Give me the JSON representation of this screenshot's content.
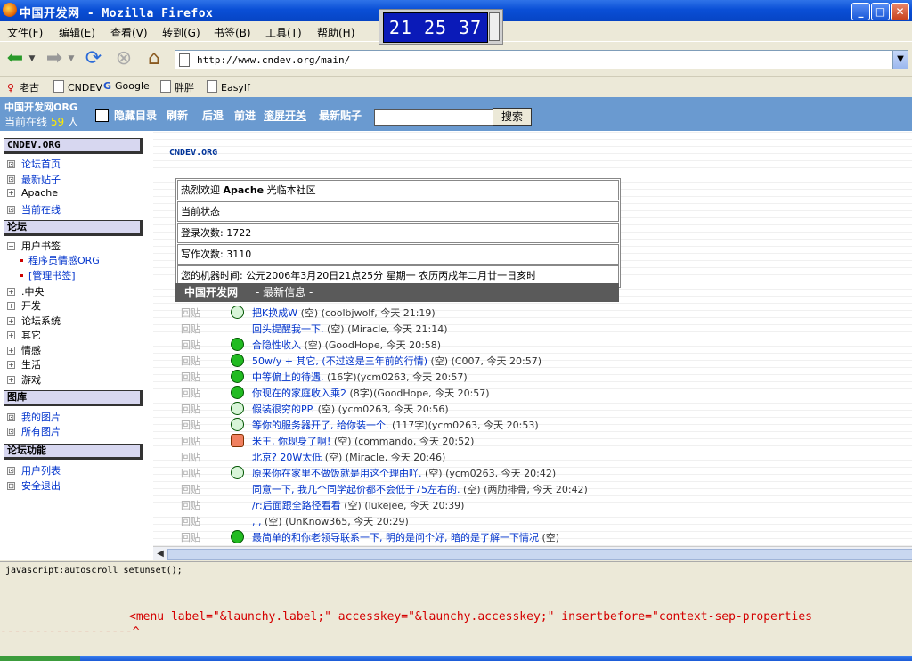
{
  "window": {
    "title": "中国开发网 - Mozilla Firefox",
    "clock": "21 25 37",
    "buttons": {
      "minimize": "_",
      "maximize": "□",
      "close": "✕"
    }
  },
  "menu": [
    "文件(F)",
    "编辑(E)",
    "查看(V)",
    "转到(G)",
    "书签(B)",
    "工具(T)",
    "帮助(H)"
  ],
  "address": {
    "url": "http://www.cndev.org/main/"
  },
  "bookmarks": [
    "老古",
    "CNDEV",
    "Google",
    "胖胖",
    "Easylf"
  ],
  "forum_bar": {
    "brand": "中国开发网ORG",
    "online_prefix": "当前在线",
    "online_count": "59",
    "online_suffix": "人",
    "toolbar": [
      "隐藏目录",
      "刷新",
      "后退",
      "前进",
      "滚屏开关",
      "最新贴子"
    ],
    "search_label": "搜索"
  },
  "sidebar": {
    "section1": "CNDEV.ORG",
    "items1": [
      {
        "box": "⊡",
        "label": "论坛首页"
      },
      {
        "box": "⊡",
        "label": "最新贴子"
      },
      {
        "box": "+",
        "label": "Apache"
      },
      {
        "box": "⊡",
        "label": "当前在线"
      }
    ],
    "section2": "论坛",
    "items2": [
      {
        "box": "−",
        "label": "用户书签"
      }
    ],
    "sub2": [
      "程序员情感ORG",
      "[管理书签]"
    ],
    "items2b": [
      {
        "box": "+",
        "label": ".中央"
      },
      {
        "box": "+",
        "label": "开发"
      },
      {
        "box": "+",
        "label": "论坛系统"
      },
      {
        "box": "+",
        "label": "其它"
      },
      {
        "box": "+",
        "label": "情感"
      },
      {
        "box": "+",
        "label": "生活"
      },
      {
        "box": "+",
        "label": "游戏"
      }
    ],
    "section3": "图库",
    "items3": [
      {
        "box": "⊡",
        "label": "我的图片"
      },
      {
        "box": "⊡",
        "label": "所有图片"
      }
    ],
    "section4": "论坛功能",
    "items4": [
      {
        "box": "⊡",
        "label": "用户列表"
      },
      {
        "box": "⊡",
        "label": "安全退出"
      }
    ]
  },
  "main": {
    "site_title": "CNDEV.ORG",
    "welcome_prefix": "热烈欢迎",
    "welcome_user": "Apache",
    "welcome_suffix": "光临本社区",
    "status_title": "当前状态",
    "login_count": "登录次数: 1722",
    "post_count": "写作次数: 3110",
    "machine_time": "您的机器时间: 公元2006年3月20日21点25分 星期一 农历丙戌年二月廿一日亥时",
    "news_title": "中国开发网",
    "news_subtitle": "- 最新信息 -",
    "reply_label": "回贴",
    "news": [
      {
        "title": "把K换成W",
        "meta": "(空) (coolbjwolf, 今天 21:19)",
        "emote": "ring"
      },
      {
        "title": "回头提醒我一下.",
        "meta": "(空) (Miracle, 今天 21:14)",
        "emote": "none"
      },
      {
        "title": "合隐性收入",
        "meta": "(空) (GoodHope, 今天 20:58)",
        "emote": "smile"
      },
      {
        "title": "50w/y + 其它, (不过这是三年前的行情)",
        "meta": "(空) (C007, 今天 20:57)",
        "emote": "smile"
      },
      {
        "title": "中等偏上的待遇,",
        "meta": "(16字)(ycm0263, 今天 20:57)",
        "emote": "smile"
      },
      {
        "title": "你现在的家庭收入乘2",
        "meta": "(8字)(GoodHope, 今天 20:57)",
        "emote": "smile"
      },
      {
        "title": "假装很穷的PP.",
        "meta": "(空) (ycm0263, 今天 20:56)",
        "emote": "ring"
      },
      {
        "title": "等你的服务器开了, 给你装一个.",
        "meta": "(117字)(ycm0263, 今天 20:53)",
        "emote": "ring"
      },
      {
        "title": "米王, 你现身了啊!",
        "meta": "(空) (commando, 今天 20:52)",
        "emote": "hand"
      },
      {
        "title": "北京? 20W太低",
        "meta": "(空) (Miracle, 今天 20:46)",
        "emote": "none"
      },
      {
        "title": "原来你在家里不做饭就是用这个理由吖.",
        "meta": "(空) (ycm0263, 今天 20:42)",
        "emote": "ring"
      },
      {
        "title": "同意一下, 我几个同学起价都不会低于75左右的.",
        "meta": "(空) (两肋排骨, 今天 20:42)",
        "emote": "none"
      },
      {
        "title": "/r:后面跟全路径看看",
        "meta": "(空) (lukejee, 今天 20:39)",
        "emote": "none"
      },
      {
        "title": ", ,",
        "meta": "(空) (UnKnow365, 今天 20:29)",
        "emote": "none"
      },
      {
        "title": "最简单的和你老领导联系一下, 明的是问个好, 暗的是了解一下情况",
        "meta": "(空)",
        "emote": "smile"
      }
    ]
  },
  "status_text": "javascript:autoscroll_setunset();",
  "error": {
    "code": "<menu label=\"&launchy.label;\" accesskey=\"&launchy.accesskey;\" insertbefore=\"context-sep-properties",
    "pointer": "-------------------^"
  },
  "icons": {
    "back": "back-arrow-icon",
    "forward": "forward-arrow-icon",
    "reload": "reload-icon",
    "stop": "stop-icon",
    "home": "home-icon"
  }
}
